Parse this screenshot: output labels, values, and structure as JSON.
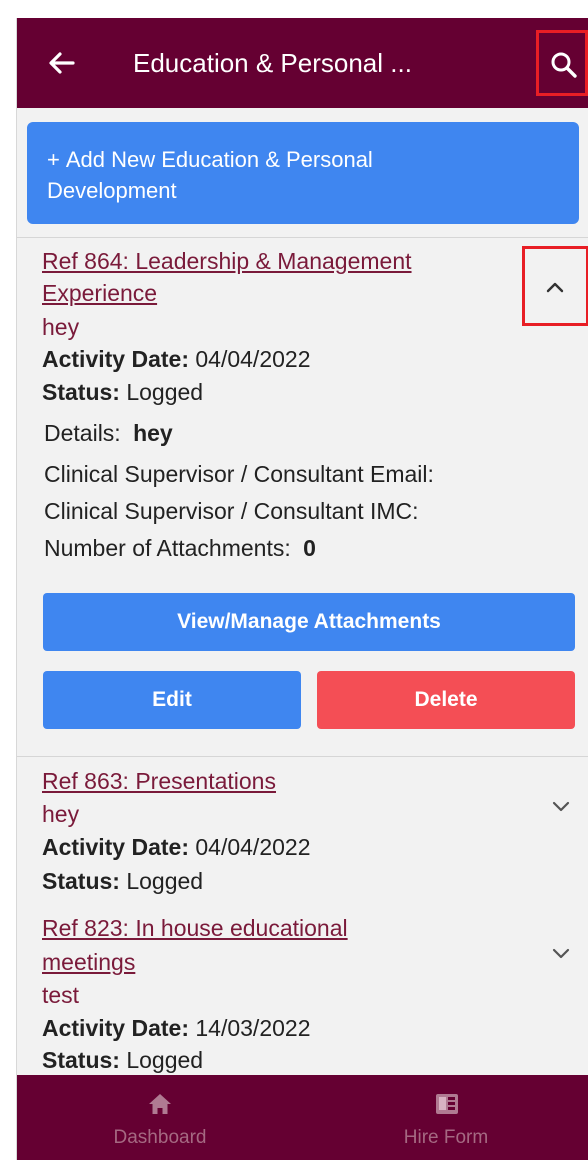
{
  "header": {
    "title": "Education & Personal ...",
    "back_icon": "arrow-left-icon",
    "search_icon": "search-icon"
  },
  "add_button": {
    "plus": "+",
    "label_line1": "Add New Education & Personal",
    "label_line2": "Development"
  },
  "expanded_entry": {
    "title_line1": "Ref 864: Leadership & Management",
    "title_line2": "Experience",
    "subtitle": "hey",
    "activity_date_label": "Activity Date:",
    "activity_date": "04/04/2022",
    "status_label": "Status:",
    "status": "Logged",
    "details_label": "Details:",
    "details": "hey",
    "supervisor_email_label": "Clinical Supervisor / Consultant Email:",
    "supervisor_imc_label": "Clinical Supervisor / Consultant IMC:",
    "attachments_label": "Number of Attachments:",
    "attachments_count": "0",
    "view_attachments_button": "View/Manage Attachments",
    "edit_button": "Edit",
    "delete_button": "Delete"
  },
  "entries": [
    {
      "title_line1": "Ref 863: Presentations",
      "subtitle": "hey",
      "activity_date_label": "Activity Date:",
      "activity_date": "04/04/2022",
      "status_label": "Status:",
      "status": "Logged"
    },
    {
      "title_line1": "Ref 823: In house educational",
      "title_line2": "meetings",
      "subtitle": "test",
      "activity_date_label": "Activity Date:",
      "activity_date": "14/03/2022",
      "status_label": "Status:",
      "status": "Logged"
    }
  ],
  "bottom_nav": [
    {
      "label": "Dashboard",
      "icon": "home-icon"
    },
    {
      "label": "Hire Form",
      "icon": "form-icon"
    }
  ],
  "colors": {
    "header_bg": "#650032",
    "primary_blue": "#3f86f0",
    "danger_red": "#f44e55",
    "link_maroon": "#7a1a3a",
    "highlight_red": "#e81e25"
  }
}
